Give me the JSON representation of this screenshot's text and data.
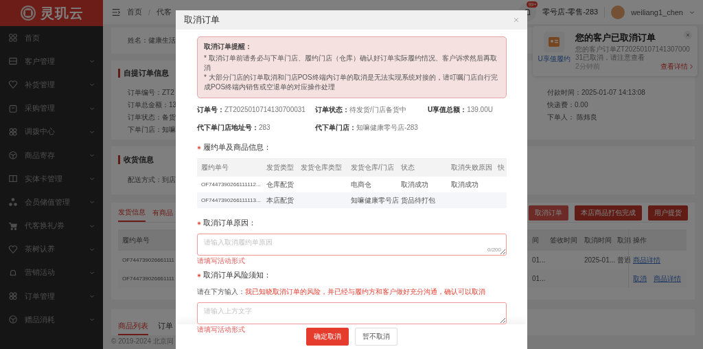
{
  "sidebar": {
    "logo": "灵玑云",
    "items": [
      {
        "label": "首页",
        "kind": "link"
      },
      {
        "label": "客户管理",
        "kind": "group"
      },
      {
        "label": "补货管理",
        "kind": "group"
      },
      {
        "label": "采购管理",
        "kind": "group"
      },
      {
        "label": "调拨中心",
        "kind": "group"
      },
      {
        "label": "商品寄存",
        "kind": "group"
      },
      {
        "label": "实体卡管理",
        "kind": "group"
      },
      {
        "label": "会员储值管理",
        "kind": "group"
      },
      {
        "label": "代客换礼/券",
        "kind": "group"
      },
      {
        "label": "茶树认养",
        "kind": "group"
      },
      {
        "label": "营销活动",
        "kind": "group"
      },
      {
        "label": "订单管理",
        "kind": "group"
      },
      {
        "label": "赠品消耗",
        "kind": "group"
      }
    ]
  },
  "topbar": {
    "breadcrumb": {
      "items": [
        "首页",
        "代客"
      ],
      "separator": "/"
    },
    "badge": "99+",
    "store": "零号店-零售-283",
    "user": "weiliang1_chen"
  },
  "toast": {
    "app_label": "U享值履约",
    "title": "您的客户已取消订单",
    "message": "您的客户订单ZT2025010714130700031已取消，请注意查看",
    "time": "2分钟前",
    "link": "查看详情"
  },
  "page": {
    "customer": "姓名：健康生活",
    "order_info": {
      "title": "自提订单信息",
      "left": [
        "订单编号：ZT2",
        "订单总金额：13",
        "订单状态：备货",
        "下单门店：知嘛"
      ],
      "right": [
        "付款时间：2025-01-07 14:13:08",
        "快递费：0.00",
        "下单人： 陈炜良"
      ]
    },
    "receiving": {
      "title": "收货信息",
      "lines": [
        "配送方式：到店"
      ]
    },
    "shipping": {
      "tabs": [
        {
          "label": "发货信息",
          "selected": true
        }
      ],
      "note": "有商品",
      "actions": [
        "取消订单",
        "本店商品打包完成",
        "用户提货"
      ],
      "columns": [
        "履约单号",
        "间",
        "签收时间",
        "取消时间",
        "取消",
        "操作"
      ],
      "rows": [
        {
          "order_no": "OF744739026661111",
          "column_2": "01...",
          "cancel_time": "2025-01...",
          "column_5": "普通",
          "actions": [
            "商品详情"
          ]
        },
        {
          "order_no": "OF744739026661111",
          "column_2": "01...",
          "actions": [
            "取消",
            "商品详情"
          ]
        }
      ]
    },
    "products": {
      "tabs": [
        {
          "label": "商品列表",
          "selected": true
        },
        {
          "label": "订单",
          "selected": false
        }
      ]
    },
    "footer": "© 2019-2024 北京同"
  },
  "dialog": {
    "title": "取消订单",
    "notice": {
      "title": "取消订单提醒：",
      "items": [
        "* 取消订单前请务必与下单门店、履约门店（仓库）确认好订单实际履约情况、客户诉求然后再取消",
        "* 大部分门店的订单取消和门店POS终端内订单的取消是无法实现系统对接的，请叮嘱门店自行完成POS终端内销售或空退单的对应操作处理"
      ]
    },
    "summary": [
      [
        {
          "label": "订单号：",
          "value": "ZT2025010714130700031"
        },
        {
          "label": "订单状态：",
          "value": "待发货/门店备货中"
        },
        {
          "label": "U享值总额：",
          "value": "139.00U"
        }
      ],
      [
        {
          "label": "代下单门店地址号：",
          "value": "283"
        },
        {
          "label": "代下单门店：",
          "value": "知嘛健康零号店-283"
        }
      ]
    ],
    "fulfillment": {
      "label": "履约单及商品信息：",
      "required": true,
      "columns": [
        "履约单号",
        "发货类型",
        "发货仓库类型",
        "发货仓库/门店",
        "状态",
        "取消失败原因",
        "快"
      ],
      "rows": [
        {
          "order_no": "OF7447390266111112...",
          "ship_type": "仓库配货",
          "store": "电商仓",
          "status": "取消成功",
          "fail_reason": "取消成功"
        },
        {
          "order_no": "OF7447390266111113...",
          "ship_type": "本店配货",
          "store": "知嘛健康零号店",
          "status": "货品待打包"
        }
      ]
    },
    "reason": {
      "label": "取消订单原因：",
      "required": true,
      "placeholder": "请输入取消履约单原因",
      "counter": "0/200",
      "error": "请填写活动形式"
    },
    "risk": {
      "label": "取消订单风险须知：",
      "required": true,
      "prompt": "请在下方输入：",
      "phrase": "我已知晓取消订单的风险，并已经与履约方和客户做好充分沟通，确认可以取消",
      "placeholder": "请输入上方文字",
      "error": "请填写活动形式"
    },
    "buttons": [
      {
        "label": "确定取消",
        "kind": "primary"
      },
      {
        "label": "暂不取消",
        "kind": "default"
      }
    ]
  }
}
